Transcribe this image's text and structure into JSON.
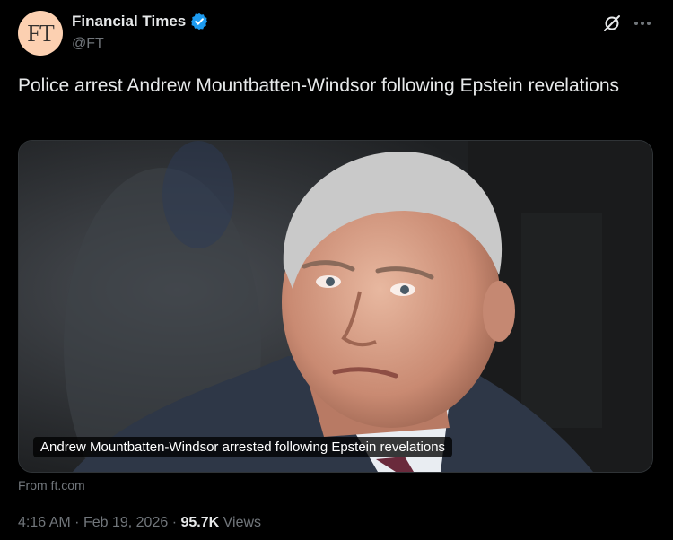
{
  "account": {
    "avatar_text": "FT",
    "display_name": "Financial Times",
    "handle": "@FT",
    "verified": true
  },
  "tweet": {
    "text": "Police arrest Andrew Mountbatten-Windsor following Epstein revelations"
  },
  "card": {
    "title": "Andrew Mountbatten-Windsor arrested following Epstein revelations",
    "source": "From ft.com"
  },
  "meta": {
    "time": "4:16 AM",
    "separator": "·",
    "date": "Feb 19, 2026",
    "views_count": "95.7K",
    "views_label": "Views"
  },
  "icons": {
    "verified": "verified-badge-icon",
    "grok": "grok-icon",
    "more": "more-options-icon"
  },
  "colors": {
    "background": "#000000",
    "text_primary": "#e7e9ea",
    "text_secondary": "#71767b",
    "verified_blue": "#1d9bf0",
    "avatar_bg": "#fcd0b1",
    "card_border": "#2f3336"
  }
}
